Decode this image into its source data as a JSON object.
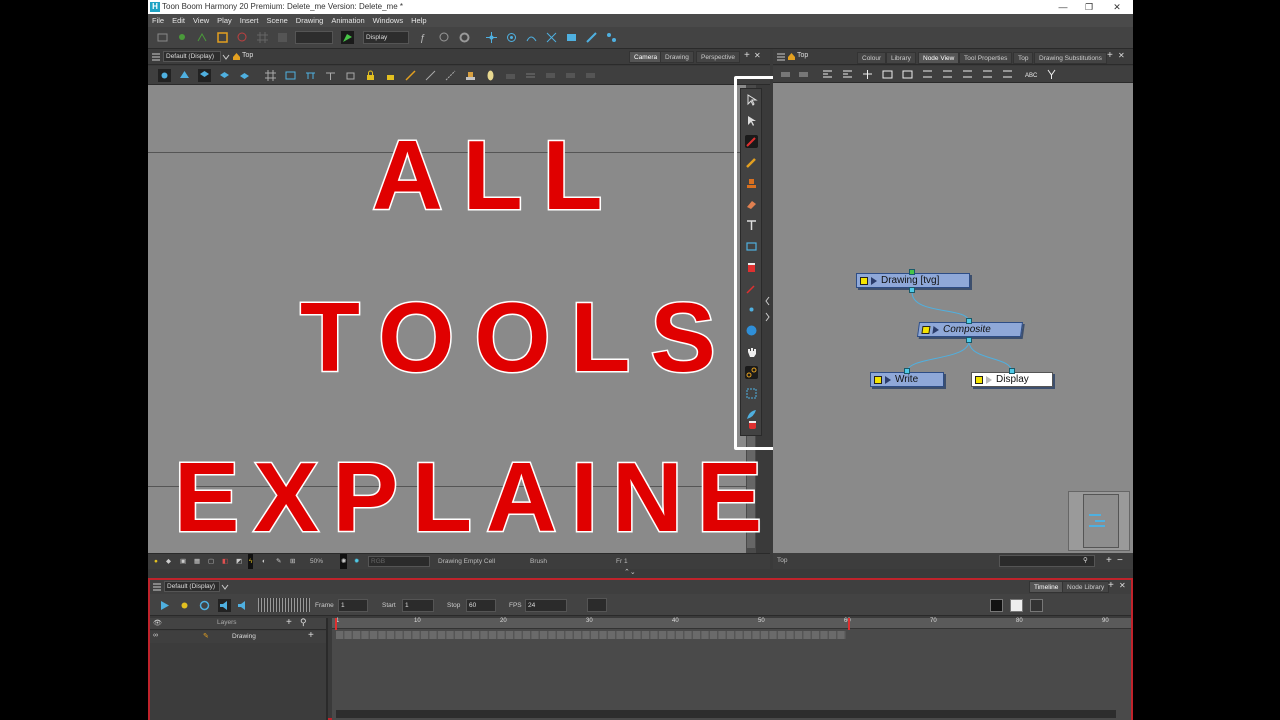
{
  "titlebar": {
    "title": "Toon Boom Harmony 20 Premium: Delete_me Version: Delete_me *",
    "minimize": "—",
    "maximize": "❐",
    "close": "✕"
  },
  "menubar": {
    "items": [
      "File",
      "Edit",
      "View",
      "Play",
      "Insert",
      "Scene",
      "Drawing",
      "Animation",
      "Windows",
      "Help"
    ]
  },
  "toolbar": {
    "display_select": "Display"
  },
  "camera_view": {
    "display_select": "Default (Display)",
    "top_label": "Top",
    "tabs": [
      "Camera",
      "Drawing",
      "Perspective"
    ],
    "active_tab": "Camera",
    "zoom": "50%",
    "color_mode": "RGB",
    "status_cell": "Drawing Empty Cell",
    "status_tool": "Brush",
    "status_frame": "Fr 1"
  },
  "overlay": {
    "line1": "ALL",
    "line2": "TOOLS",
    "line3": "EXPLAINED!",
    "color": "#e00000"
  },
  "node_view": {
    "top_label": "Top",
    "tabs": [
      "Colour",
      "Library",
      "Node View",
      "Tool Properties",
      "Top",
      "Drawing Substitutions"
    ],
    "active_tab": "Node View",
    "status_left": "Top",
    "nodes": [
      {
        "label": "Drawing  [tvg]"
      },
      {
        "label": "Composite"
      },
      {
        "label": "Write"
      },
      {
        "label": "Display"
      }
    ]
  },
  "timeline": {
    "display_select": "Default (Display)",
    "tabs": [
      "Timeline",
      "Node Library"
    ],
    "active_tab": "Timeline",
    "frame_label": "Frame",
    "frame_value": "1",
    "start_label": "Start",
    "start_value": "1",
    "stop_label": "Stop",
    "stop_value": "60",
    "fps_label": "FPS",
    "fps_value": "24",
    "layers_header": "Layers",
    "layer_name": "Drawing",
    "ruler_ticks": [
      "1",
      "10",
      "20",
      "30",
      "40",
      "50",
      "60",
      "70",
      "80",
      "90"
    ]
  }
}
